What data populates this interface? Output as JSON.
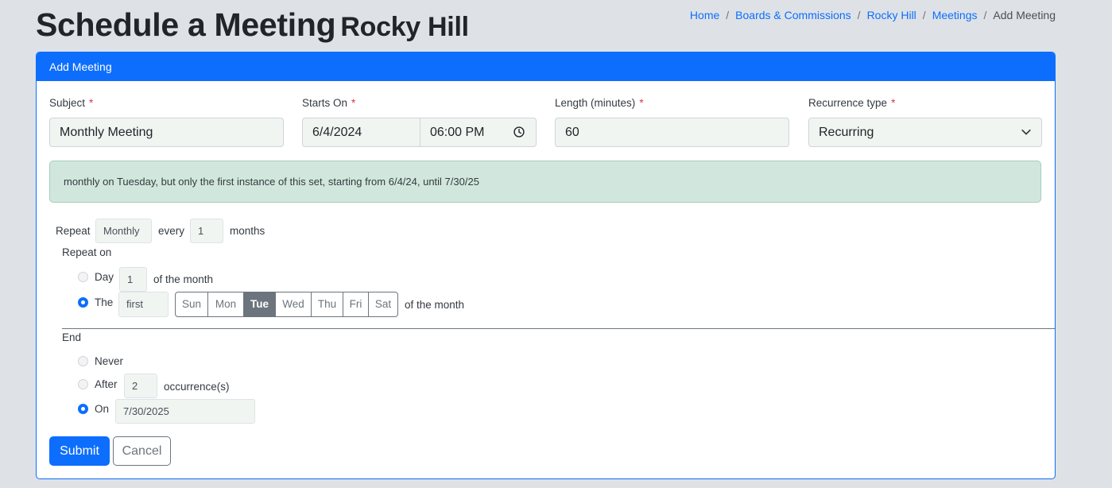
{
  "header": {
    "title": "Schedule a Meeting",
    "subtitle": "Rocky Hill"
  },
  "breadcrumb": {
    "items": [
      "Home",
      "Boards & Commissions",
      "Rocky Hill",
      "Meetings"
    ],
    "current": "Add Meeting"
  },
  "card": {
    "title": "Add Meeting"
  },
  "form": {
    "subject": {
      "label": "Subject",
      "value": "Monthly Meeting"
    },
    "starts_on": {
      "label": "Starts On",
      "date": "6/4/2024",
      "time": "06:00 PM"
    },
    "length": {
      "label": "Length (minutes)",
      "value": "60"
    },
    "recurrence_type": {
      "label": "Recurrence type",
      "value": "Recurring"
    },
    "required_marker": "*"
  },
  "summary": "monthly on Tuesday, but only the first instance of this set, starting from 6/4/24, until 7/30/25",
  "repeat": {
    "label": "Repeat",
    "frequency": "Monthly",
    "every_label": "every",
    "interval": "1",
    "unit_label": "months",
    "repeat_on_label": "Repeat on",
    "day_option_label": "Day",
    "day_value": "1",
    "of_month_label": "of the month",
    "the_option_label": "The",
    "ordinal": "first",
    "weekdays": [
      "Sun",
      "Mon",
      "Tue",
      "Wed",
      "Thu",
      "Fri",
      "Sat"
    ],
    "selected_weekday": "Tue",
    "selected_option": "The"
  },
  "end": {
    "label": "End",
    "never_label": "Never",
    "after_label": "After",
    "occurrences": "2",
    "occurrences_label": "occurrence(s)",
    "on_label": "On",
    "on_date": "7/30/2025",
    "selected_option": "On"
  },
  "buttons": {
    "submit": "Submit",
    "cancel": "Cancel"
  },
  "colors": {
    "primary": "#0d6efd",
    "alert_bg": "#d1e7dd",
    "page_bg": "#dee2e6",
    "required": "#dc3545"
  },
  "icons": [
    "clock-icon",
    "chevron-down-icon"
  ]
}
